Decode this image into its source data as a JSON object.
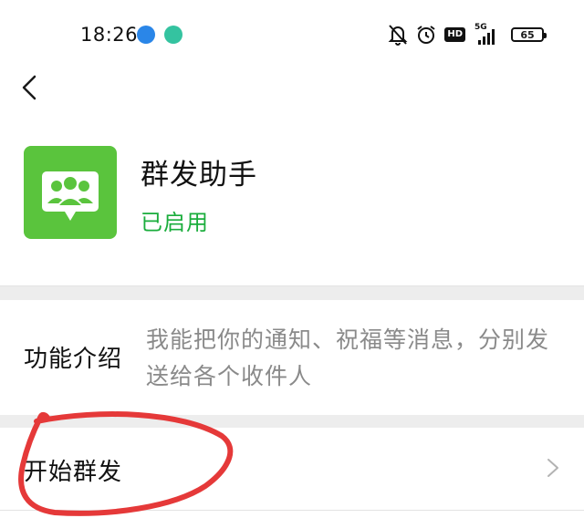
{
  "status_bar": {
    "time": "18:26",
    "network": "5G",
    "battery": "65",
    "hd_badge": "HD"
  },
  "app": {
    "name": "群发助手",
    "status": "已启用",
    "icon_color": "#5ac43d",
    "status_color": "#1aad3c"
  },
  "intro": {
    "label": "功能介绍",
    "description": "我能把你的通知、祝福等消息，分别发送给各个收件人"
  },
  "action": {
    "label": "开始群发"
  },
  "annotation_color": "#e53939"
}
